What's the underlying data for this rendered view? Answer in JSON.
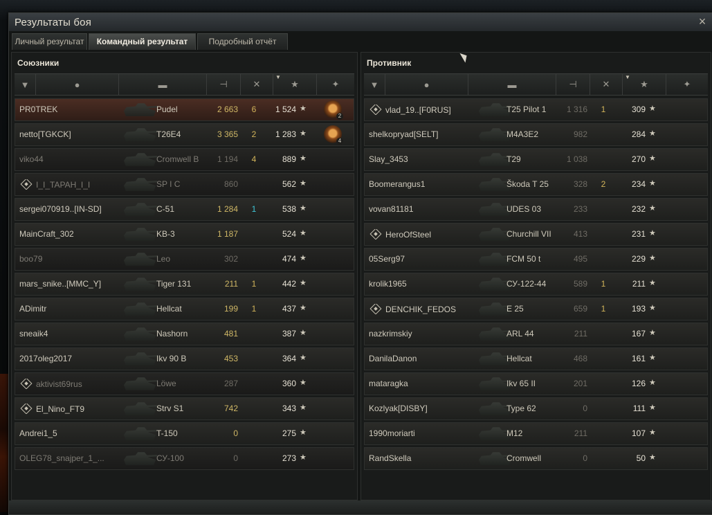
{
  "window": {
    "title": "Результаты боя",
    "close_glyph": "×"
  },
  "tabs": [
    {
      "label": "Личный результат"
    },
    {
      "label": "Командный результат",
      "active": true
    },
    {
      "label": "Подробный отчёт"
    }
  ],
  "left": {
    "title": "Союзники",
    "rows": [
      {
        "name": "PR0TREK",
        "tank": "Pudel",
        "damage": "2 663",
        "kills": "6",
        "xp": "1 524",
        "medal": "2",
        "state": "me"
      },
      {
        "name": "netto[TGKCK]",
        "tank": "T26E4",
        "damage": "3 365",
        "kills": "2",
        "xp": "1 283",
        "medal": "4",
        "state": "alive"
      },
      {
        "name": "viko44",
        "tank": "Cromwell B",
        "damage": "1 194",
        "kills": "4",
        "xp": "889",
        "state": "dead"
      },
      {
        "name": "I_I_TAPAH_I_I",
        "tank": "SP I C",
        "damage": "860",
        "kills": "",
        "xp": "562",
        "platoon": true,
        "state": "dead"
      },
      {
        "name": "sergei070919..[IN-SD]",
        "tank": "C-51",
        "damage": "1 284",
        "kills": "1",
        "kills_cyan": true,
        "xp": "538",
        "state": "alive"
      },
      {
        "name": "MainCraft_302",
        "tank": "KB-3",
        "damage": "1 187",
        "kills": "",
        "xp": "524",
        "state": "alive"
      },
      {
        "name": "boo79",
        "tank": "Leo",
        "damage": "302",
        "kills": "",
        "xp": "474",
        "state": "dead"
      },
      {
        "name": "mars_snike..[MMC_Y]",
        "tank": "Tiger 131",
        "damage": "211",
        "kills": "1",
        "xp": "442",
        "state": "alive"
      },
      {
        "name": "ADimitr",
        "tank": "Hellcat",
        "damage": "199",
        "kills": "1",
        "xp": "437",
        "state": "alive"
      },
      {
        "name": "sneaik4",
        "tank": "Nashorn",
        "damage": "481",
        "kills": "",
        "xp": "387",
        "state": "alive"
      },
      {
        "name": "2017oleg2017",
        "tank": "Ikv 90 B",
        "damage": "453",
        "kills": "",
        "xp": "364",
        "state": "alive"
      },
      {
        "name": "aktivist69rus",
        "tank": "Löwe",
        "damage": "287",
        "kills": "",
        "xp": "360",
        "platoon": true,
        "state": "dead"
      },
      {
        "name": "El_Nino_FT9",
        "tank": "Strv S1",
        "damage": "742",
        "kills": "",
        "xp": "343",
        "platoon": true,
        "state": "alive"
      },
      {
        "name": "Andrei1_5",
        "tank": "T-150",
        "damage": "0",
        "kills": "",
        "xp": "275",
        "state": "alive"
      },
      {
        "name": "OLEG78_snajper_1_...",
        "tank": "СУ-100",
        "damage": "0",
        "kills": "",
        "xp": "273",
        "state": "dead"
      }
    ]
  },
  "right": {
    "title": "Противник",
    "rows": [
      {
        "name": "vlad_19..[F0RUS]",
        "tank": "T25 Pilot 1",
        "damage": "1 316",
        "kills": "1",
        "xp": "309",
        "platoon": true
      },
      {
        "name": "shelkopryad[SELT]",
        "tank": "M4A3E2",
        "damage": "982",
        "kills": "",
        "xp": "284"
      },
      {
        "name": "Slay_3453",
        "tank": "T29",
        "damage": "1 038",
        "kills": "",
        "xp": "270"
      },
      {
        "name": "Boomerangus1",
        "tank": "Škoda T 25",
        "damage": "328",
        "kills": "2",
        "xp": "234"
      },
      {
        "name": "vovan81181",
        "tank": "UDES 03",
        "damage": "233",
        "kills": "",
        "xp": "232"
      },
      {
        "name": "HeroOfSteel",
        "tank": "Churchill VII",
        "damage": "413",
        "kills": "",
        "xp": "231",
        "platoon": true
      },
      {
        "name": "05Serg97",
        "tank": "FCM 50 t",
        "damage": "495",
        "kills": "",
        "xp": "229"
      },
      {
        "name": "krolik1965",
        "tank": "СУ-122-44",
        "damage": "589",
        "kills": "1",
        "xp": "211"
      },
      {
        "name": "DENCHIK_FEDOS",
        "tank": "E 25",
        "damage": "659",
        "kills": "1",
        "xp": "193",
        "platoon": true
      },
      {
        "name": "nazkrimskiy",
        "tank": "ARL 44",
        "damage": "211",
        "kills": "",
        "xp": "167"
      },
      {
        "name": "DanilaDanon",
        "tank": "Hellcat",
        "damage": "468",
        "kills": "",
        "xp": "161"
      },
      {
        "name": "mataragka",
        "tank": "Ikv 65 II",
        "damage": "201",
        "kills": "",
        "xp": "126"
      },
      {
        "name": "Kozlyak[DISBY]",
        "tank": "Type 62",
        "damage": "0",
        "kills": "",
        "xp": "111"
      },
      {
        "name": "1990moriarti",
        "tank": "M12",
        "damage": "211",
        "kills": "",
        "xp": "107"
      },
      {
        "name": "RandSkella",
        "tank": "Cromwell",
        "damage": "0",
        "kills": "",
        "xp": "50"
      }
    ]
  },
  "header_icons": {
    "squad": "▼",
    "player": "●",
    "tank": "▬",
    "damage": "⊣",
    "kills": "✕",
    "xp": "★",
    "medal": "✦"
  },
  "star_glyph": "★",
  "colors": {
    "me_row": "#4b2d23",
    "damage": "#cfb766",
    "kills": "#d2b45a",
    "kills_cyan": "#3fc6d6"
  }
}
